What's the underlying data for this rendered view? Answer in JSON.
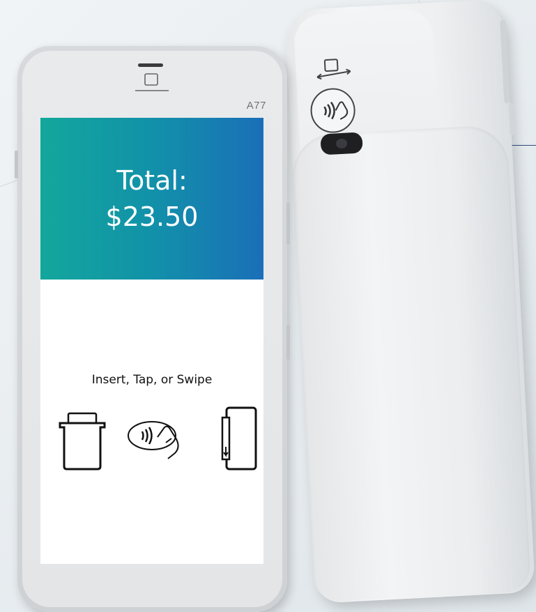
{
  "device": {
    "model": "A77"
  },
  "screen": {
    "total_label": "Total:",
    "total_value": "$23.50",
    "prompt": "Insert, Tap, or Swipe"
  },
  "icons": {
    "insert": "card-insert-icon",
    "tap": "contactless-tap-icon",
    "swipe": "card-swipe-icon"
  },
  "colors": {
    "header_start": "#13a79c",
    "header_end": "#1a6fb8"
  }
}
